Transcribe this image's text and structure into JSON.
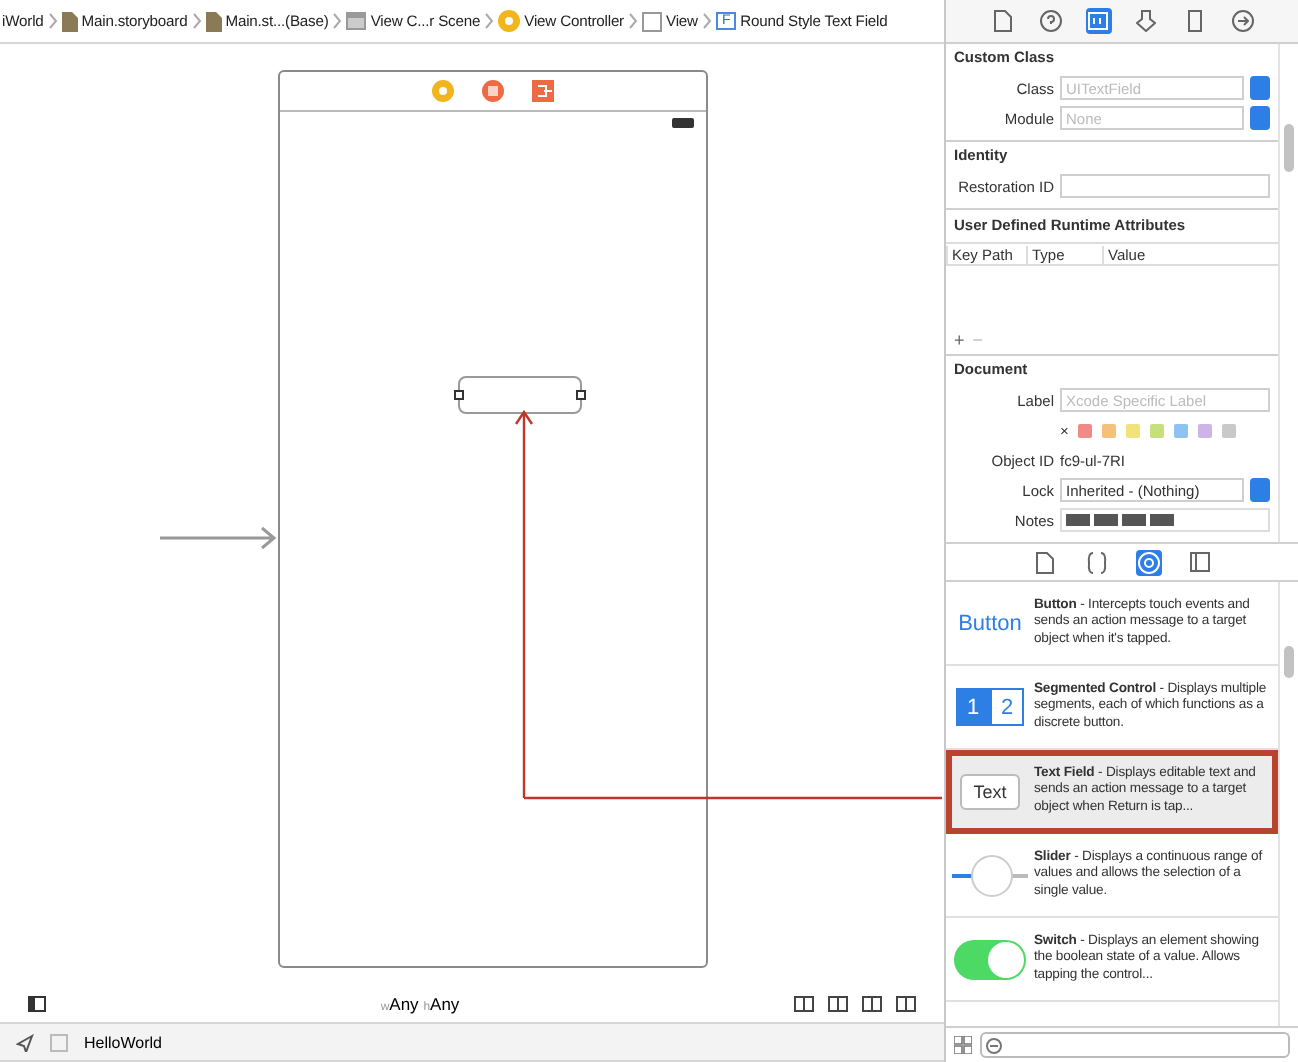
{
  "breadcrumb": [
    {
      "kind": "none",
      "label": "iWorld"
    },
    {
      "kind": "file",
      "label": "Main.storyboard"
    },
    {
      "kind": "file",
      "label": "Main.st...(Base)"
    },
    {
      "kind": "scene",
      "label": "View C...r Scene"
    },
    {
      "kind": "controller",
      "label": "View Controller"
    },
    {
      "kind": "view",
      "label": "View"
    },
    {
      "kind": "field",
      "label": "Round Style Text Field",
      "icon_text": "F"
    }
  ],
  "canvas": {
    "size_class": {
      "w_prefix": "w",
      "w_value": "Any",
      "h_prefix": "h",
      "h_value": "Any"
    }
  },
  "debug_bar": {
    "target": "HelloWorld"
  },
  "inspector_tabs": [
    {
      "kind": "file",
      "selected": false
    },
    {
      "kind": "help",
      "selected": false
    },
    {
      "kind": "identity",
      "selected": true
    },
    {
      "kind": "attributes",
      "selected": false
    },
    {
      "kind": "size",
      "selected": false
    },
    {
      "kind": "connections",
      "selected": false
    }
  ],
  "custom_class": {
    "title": "Custom Class",
    "class_label": "Class",
    "class_placeholder": "UITextField",
    "module_label": "Module",
    "module_placeholder": "None"
  },
  "identity": {
    "title": "Identity",
    "restoration_label": "Restoration ID"
  },
  "runtime_attributes": {
    "title": "User Defined Runtime Attributes",
    "columns": [
      "Key Path",
      "Type",
      "Value"
    ],
    "add": "+",
    "remove": "−"
  },
  "document": {
    "title": "Document",
    "label_label": "Label",
    "label_placeholder": "Xcode Specific Label",
    "clear": "×",
    "colors": [
      {
        "color": "#f08a84"
      },
      {
        "color": "#f5c07a"
      },
      {
        "color": "#f2e27a"
      },
      {
        "color": "#c6e07e"
      },
      {
        "color": "#8cc3f2"
      },
      {
        "color": "#cdb4e6"
      },
      {
        "color": "#c9c9c9"
      }
    ],
    "object_id_label": "Object ID",
    "object_id": "fc9-ul-7RI",
    "lock_label": "Lock",
    "lock_value": "Inherited - (Nothing)",
    "notes_label": "Notes"
  },
  "library_tabs": [
    {
      "kind": "file",
      "selected": false
    },
    {
      "kind": "code",
      "selected": false
    },
    {
      "kind": "object",
      "selected": true
    },
    {
      "kind": "media",
      "selected": false
    }
  ],
  "library": [
    {
      "kind": "button",
      "preview": "Button",
      "text": "**Button** - Intercepts touch events and sends an action message to a target object when it's tapped.",
      "selected": false
    },
    {
      "kind": "segmented",
      "preview": [
        "1",
        "2"
      ],
      "text": "**Segmented Control** - Displays multiple segments, each of which functions as a discrete button.",
      "selected": false
    },
    {
      "kind": "textfield",
      "preview": "Text",
      "text": "**Text Field** - Displays editable text and sends an action message to a target object when Return is tap...",
      "selected": true
    },
    {
      "kind": "slider",
      "text": "**Slider** - Displays a continuous range of values and allows the selection of a single value.",
      "selected": false
    },
    {
      "kind": "switch",
      "text": "**Switch** - Displays an element showing the boolean state of a value. Allows tapping the control...",
      "selected": false
    }
  ]
}
